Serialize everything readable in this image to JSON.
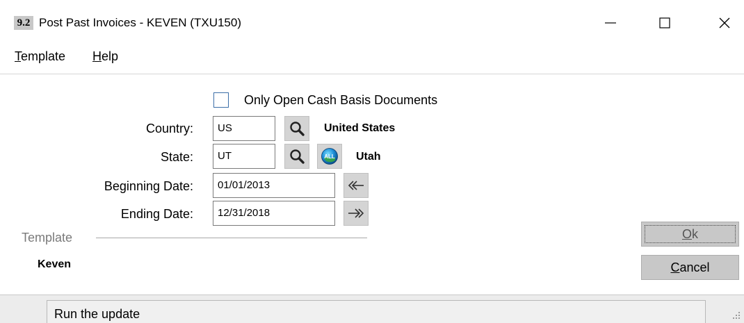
{
  "window": {
    "badge": "9.2",
    "title": "Post Past Invoices - KEVEN (TXU150)",
    "controls": [
      "minimize-icon",
      "maximize-icon",
      "close-icon"
    ]
  },
  "menu": {
    "template": {
      "mnemonic": "T",
      "rest": "emplate"
    },
    "help": {
      "mnemonic": "H",
      "rest": "elp"
    }
  },
  "filters": {
    "only_open_label": "Only Open Cash Basis Documents",
    "only_open_checked": false,
    "country": {
      "label": "Country:",
      "value": "US",
      "description": "United States",
      "lookup_icon": "search-icon"
    },
    "state": {
      "label": "State:",
      "value": "UT",
      "description": "Utah",
      "lookup_icon": "search-icon",
      "all_icon": "all-globe-icon",
      "all_text": "ALL"
    },
    "beginning_date": {
      "label": "Beginning Date:",
      "value": "01/01/2013",
      "icon": "double-arrow-left-icon"
    },
    "ending_date": {
      "label": "Ending Date:",
      "value": "12/31/2018",
      "icon": "double-arrow-right-icon"
    }
  },
  "template_section": {
    "heading": "Template",
    "value": "Keven"
  },
  "actions": {
    "ok": {
      "mnemonic": "O",
      "rest": "k"
    },
    "cancel": {
      "mnemonic": "C",
      "rest": "ancel"
    }
  },
  "status": {
    "text": "Run the update"
  },
  "colors": {
    "button_face": "#d4d4d4",
    "checkbox_border": "#3c6fa8",
    "section_text": "#7a7a7a"
  }
}
